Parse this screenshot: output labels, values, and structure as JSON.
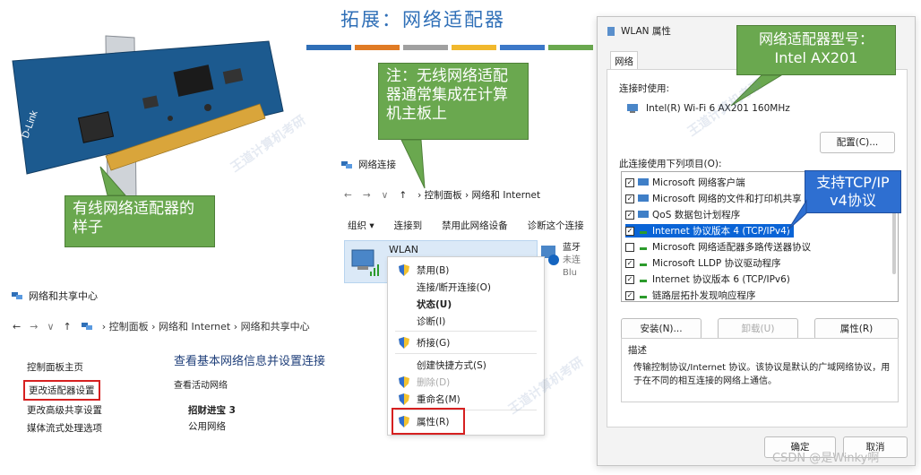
{
  "slide": {
    "title": "拓展：网络适配器",
    "color_bar": [
      "#2f6fb7",
      "#e07b25",
      "#a0a0a0",
      "#f1b82d",
      "#3c78c8",
      "#6aa84f"
    ]
  },
  "callouts": {
    "wired": "有线网络适配器的样子",
    "note": "注：无线网络适配器通常集成在计算机主板上",
    "model": "网络适配器型号：Intel AX201",
    "tcp": "支持TCP/IP v4协议"
  },
  "nic_image": {
    "brand": "D-Link"
  },
  "network_sharing_center": {
    "title": "网络和共享中心",
    "breadcrumb": [
      "控制面板",
      "网络和 Internet",
      "网络和共享中心"
    ],
    "sidebar": [
      "控制面板主页",
      "更改适配器设置",
      "更改高级共享设置",
      "媒体流式处理选项"
    ],
    "heading": "查看基本网络信息并设置连接",
    "subheading": "查看活动网络",
    "network_name": "招财进宝 3",
    "network_type": "公用网络"
  },
  "network_connections": {
    "title": "网络连接",
    "breadcrumb": [
      "控制面板",
      "网络和 Internet"
    ],
    "toolbar": [
      "组织 ▾",
      "连接到",
      "禁用此网络设备",
      "诊断这个连接"
    ],
    "wlan_label": "WLAN",
    "bt_name": "蓝牙",
    "bt_status": "未连",
    "bt_device": "Blu"
  },
  "context_menu": {
    "items": [
      {
        "label": "禁用(B)",
        "shield": true,
        "style": "normal"
      },
      {
        "label": "连接/断开连接(O)",
        "shield": false,
        "style": "normal"
      },
      {
        "label": "状态(U)",
        "shield": false,
        "style": "bold"
      },
      {
        "label": "诊断(I)",
        "shield": false,
        "style": "normal"
      },
      {
        "label": "桥接(G)",
        "shield": true,
        "style": "normal"
      },
      {
        "label": "创建快捷方式(S)",
        "shield": false,
        "style": "normal"
      },
      {
        "label": "删除(D)",
        "shield": true,
        "style": "disabled"
      },
      {
        "label": "重命名(M)",
        "shield": true,
        "style": "normal"
      },
      {
        "label": "属性(R)",
        "shield": true,
        "style": "normal"
      }
    ]
  },
  "wlan_properties": {
    "title": "WLAN 属性",
    "tab": "网络",
    "connect_using_label": "连接时使用:",
    "adapter_name": "Intel(R) Wi-Fi 6 AX201 160MHz",
    "configure_button": "配置(C)...",
    "items_label": "此连接使用下列项目(O):",
    "items": [
      {
        "label": "Microsoft 网络客户端",
        "checked": true,
        "selected": false
      },
      {
        "label": "Microsoft 网络的文件和打印机共享",
        "checked": true,
        "selected": false
      },
      {
        "label": "QoS 数据包计划程序",
        "checked": true,
        "selected": false
      },
      {
        "label": "Internet 协议版本 4 (TCP/IPv4)",
        "checked": true,
        "selected": true
      },
      {
        "label": "Microsoft 网络适配器多路传送器协议",
        "checked": false,
        "selected": false
      },
      {
        "label": "Microsoft LLDP 协议驱动程序",
        "checked": true,
        "selected": false
      },
      {
        "label": "Internet 协议版本 6 (TCP/IPv6)",
        "checked": true,
        "selected": false
      },
      {
        "label": "链路层拓扑发现响应程序",
        "checked": true,
        "selected": false
      }
    ],
    "install_button": "安装(N)...",
    "uninstall_button": "卸载(U)",
    "properties_button": "属性(R)",
    "description_label": "描述",
    "description_text": "传输控制协议/Internet 协议。该协议是默认的广域网络协议，用于在不同的相互连接的网络上通信。",
    "ok_button": "确定",
    "cancel_button": "取消"
  },
  "footer": {
    "credit": "CSDN @是Winky啊"
  }
}
